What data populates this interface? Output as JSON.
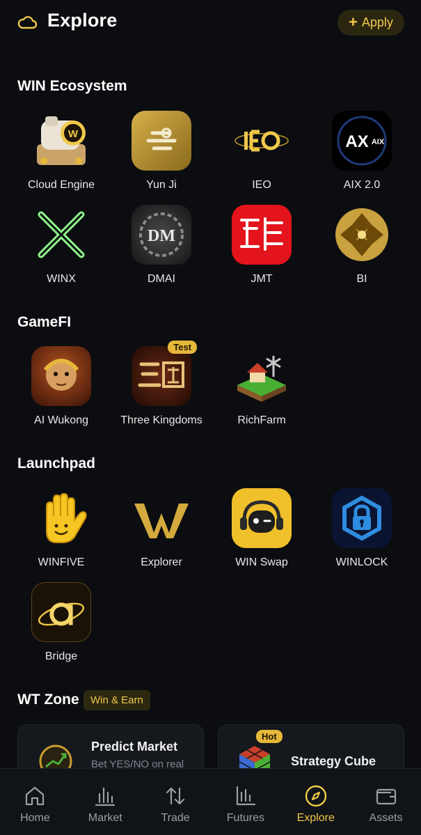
{
  "header": {
    "title": "Explore",
    "apply_label": "Apply",
    "icon": "cloud-icon",
    "accent": "#f0c84b"
  },
  "sections": {
    "ecosystem": {
      "title": "WIN Ecosystem",
      "apps": [
        {
          "label": "Cloud Engine",
          "icon": "cloud-engine-icon"
        },
        {
          "label": "Yun Ji",
          "icon": "yun-ji-icon"
        },
        {
          "label": "IEO",
          "icon": "ieo-icon"
        },
        {
          "label": "AIX 2.0",
          "icon": "aix-icon",
          "icon_text": "AIX"
        },
        {
          "label": "WINX",
          "icon": "winx-icon"
        },
        {
          "label": "DMAI",
          "icon": "dmai-icon",
          "icon_text": "DM"
        },
        {
          "label": "JMT",
          "icon": "jmt-icon"
        },
        {
          "label": "BI",
          "icon": "bi-icon"
        }
      ]
    },
    "gamefi": {
      "title": "GameFI",
      "apps": [
        {
          "label": "AI Wukong",
          "icon": "wukong-icon"
        },
        {
          "label": "Three Kingdoms",
          "icon": "three-kingdoms-icon",
          "badge": "Test"
        },
        {
          "label": "RichFarm",
          "icon": "richfarm-icon"
        }
      ]
    },
    "launchpad": {
      "title": "Launchpad",
      "apps": [
        {
          "label": "WINFIVE",
          "icon": "winfive-icon"
        },
        {
          "label": "Explorer",
          "icon": "explorer-icon"
        },
        {
          "label": "WIN Swap",
          "icon": "win-swap-icon"
        },
        {
          "label": "WINLOCK",
          "icon": "winlock-icon"
        },
        {
          "label": "Bridge",
          "icon": "bridge-icon"
        }
      ]
    },
    "wt_zone": {
      "title": "WT Zone",
      "tag": "Win & Earn",
      "cards": [
        {
          "title": "Predict Market",
          "subtitle": "Bet YES/NO on real",
          "icon": "predict-market-icon"
        },
        {
          "title": "Strategy Cube",
          "badge": "Hot",
          "icon": "strategy-cube-icon"
        }
      ]
    }
  },
  "nav": {
    "items": [
      {
        "label": "Home",
        "icon": "home-icon"
      },
      {
        "label": "Market",
        "icon": "market-icon"
      },
      {
        "label": "Trade",
        "icon": "trade-icon"
      },
      {
        "label": "Futures",
        "icon": "futures-icon"
      },
      {
        "label": "Explore",
        "icon": "explore-icon",
        "active": true
      },
      {
        "label": "Assets",
        "icon": "assets-icon"
      }
    ]
  }
}
